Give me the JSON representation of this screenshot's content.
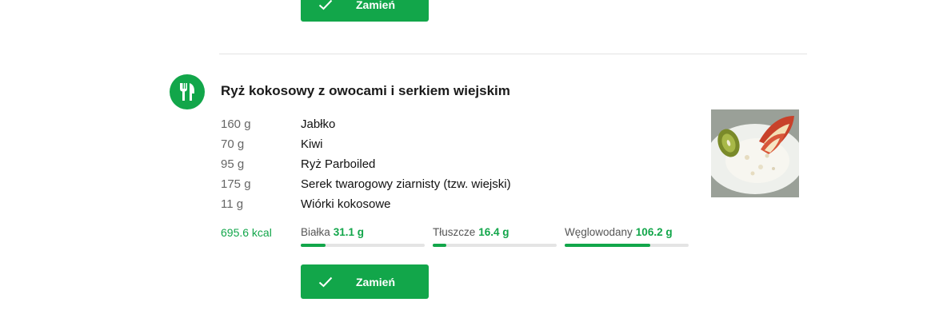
{
  "top_button": {
    "label": "Zamień"
  },
  "meal": {
    "title": "Ryż kokosowy z owocami i serkiem wiejskim",
    "ingredients": [
      {
        "amount": "160 g",
        "name": "Jabłko"
      },
      {
        "amount": "70 g",
        "name": "Kiwi"
      },
      {
        "amount": "95 g",
        "name": "Ryż Parboiled"
      },
      {
        "amount": "175 g",
        "name": "Serek twarogowy ziarnisty (tzw. wiejski)"
      },
      {
        "amount": "11 g",
        "name": "Wiórki kokosowe"
      }
    ],
    "kcal": "695.6 kcal",
    "macros": [
      {
        "name": "Białka",
        "value": "31.1 g",
        "fill_fraction": 0.2
      },
      {
        "name": "Tłuszcze",
        "value": "16.4 g",
        "fill_fraction": 0.11
      },
      {
        "name": "Węglowodany",
        "value": "106.2 g",
        "fill_fraction": 0.69
      }
    ],
    "swap_button": {
      "label": "Zamień"
    }
  },
  "colors": {
    "accent": "#12a64a",
    "track": "#e4e4e4",
    "divider": "#e3e3e3"
  },
  "icons": {
    "meal": "fork-knife-icon",
    "swap": "check-icon"
  }
}
